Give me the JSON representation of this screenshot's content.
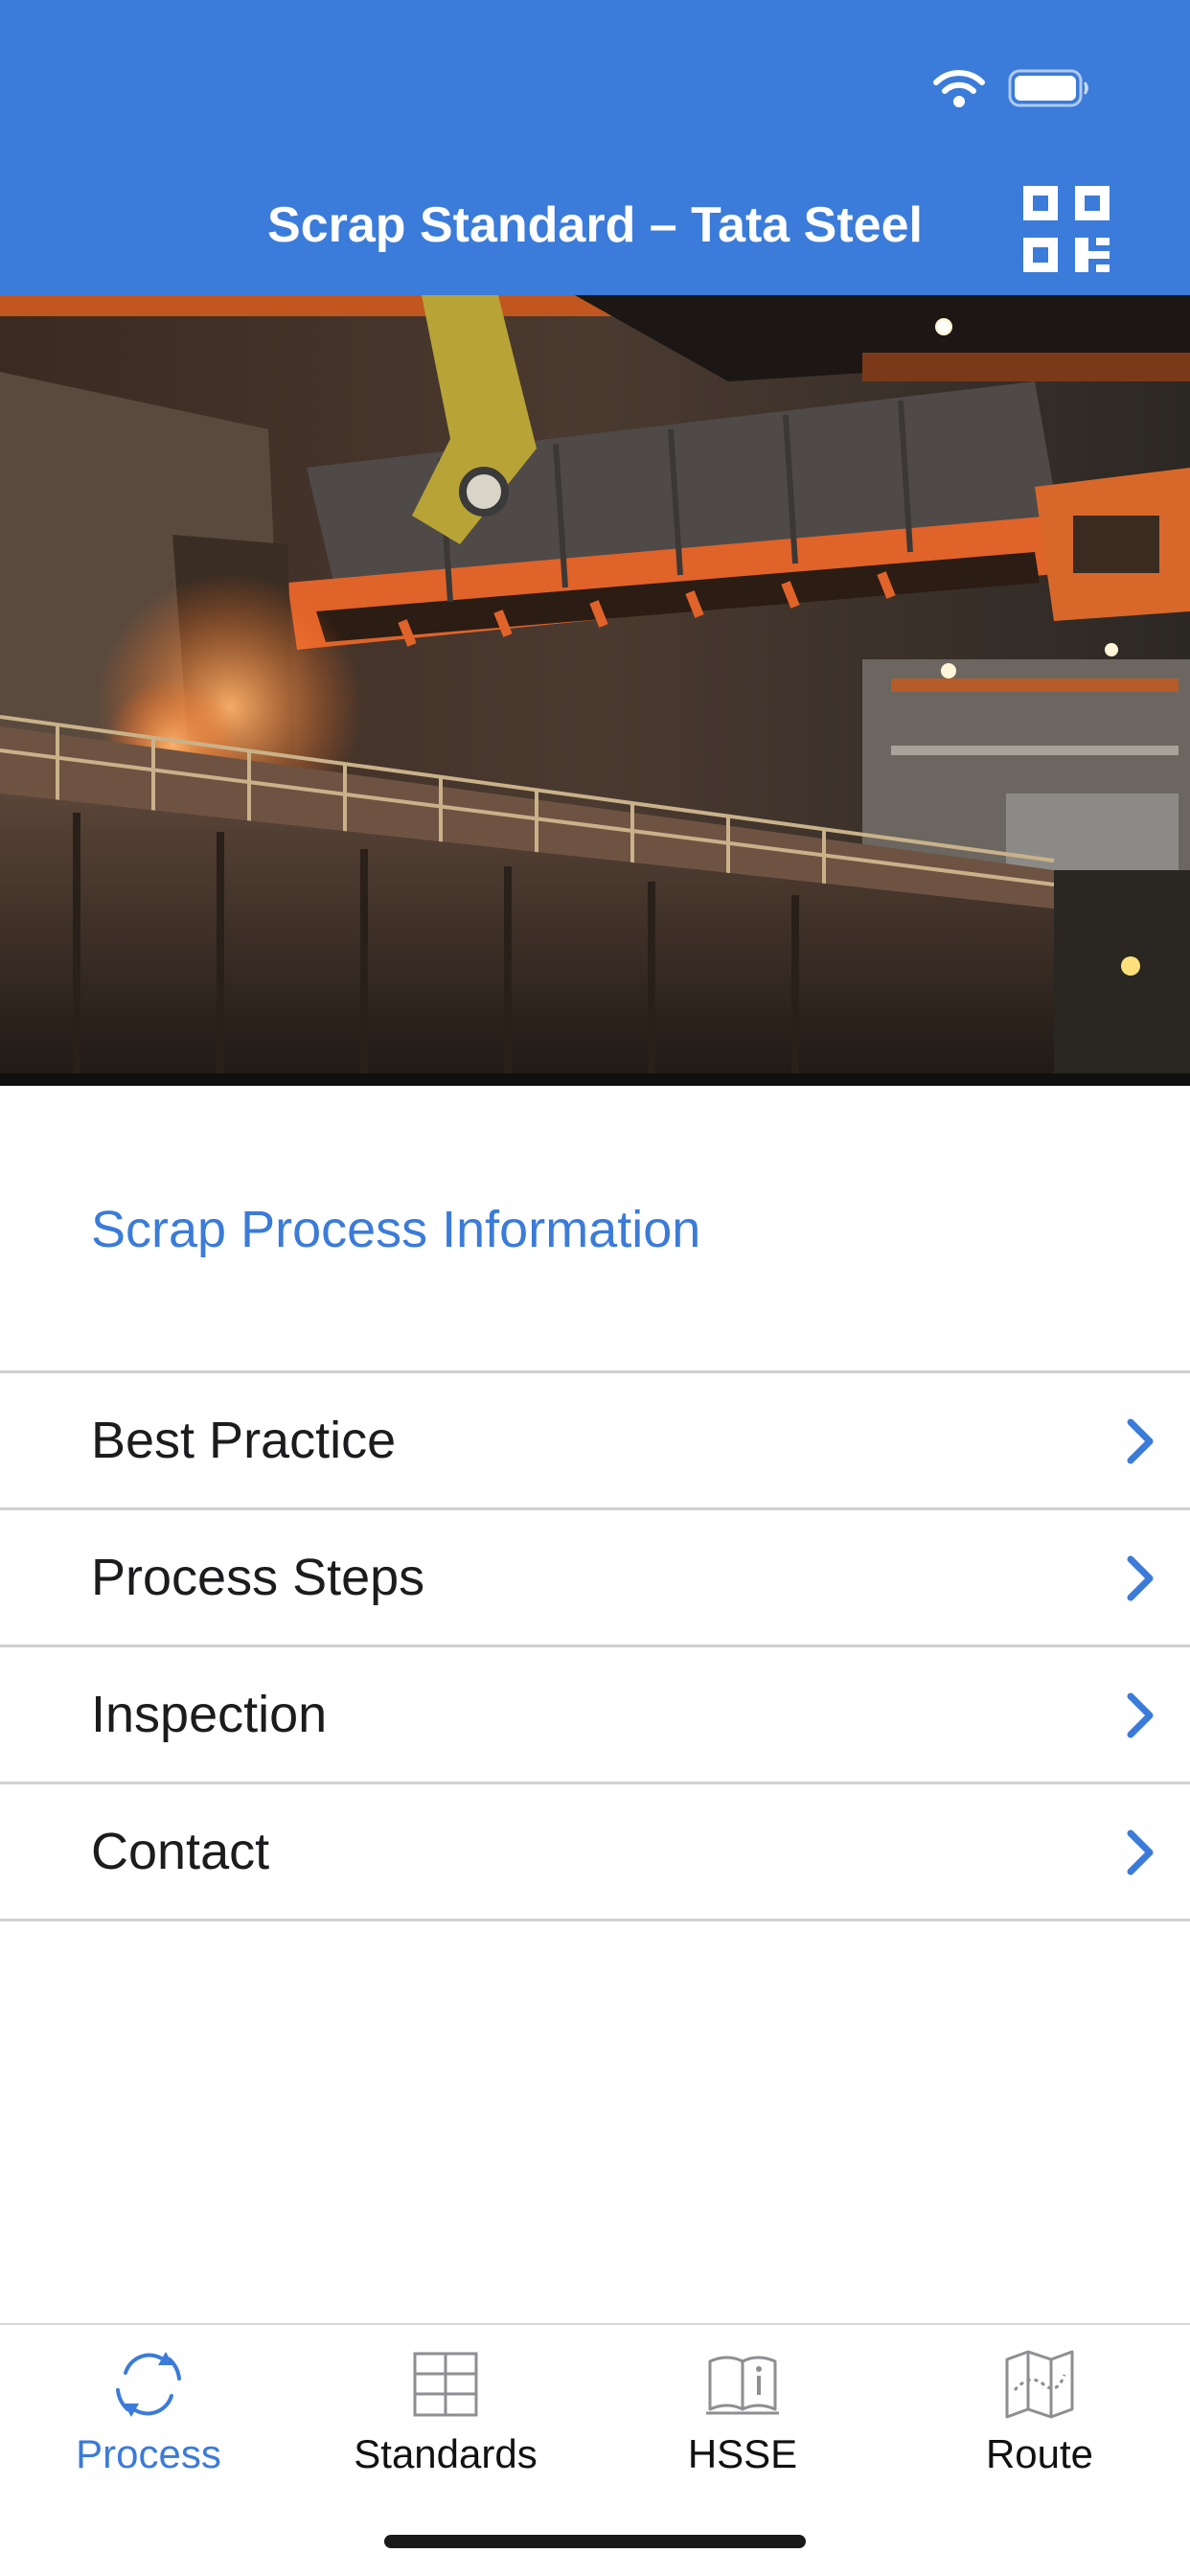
{
  "header": {
    "title": "Scrap Standard – Tata Steel",
    "bg_color": "#3b7bd9",
    "qr_icon": "qr-code-icon"
  },
  "status_bar": {
    "icons": [
      "wifi-icon",
      "battery-icon"
    ]
  },
  "hero": {
    "image": "steel-plant-crane-photo"
  },
  "section": {
    "title": "Scrap Process Information"
  },
  "menu": {
    "items": [
      {
        "label": "Best Practice"
      },
      {
        "label": "Process Steps"
      },
      {
        "label": "Inspection"
      },
      {
        "label": "Contact"
      }
    ]
  },
  "tabbar": {
    "tabs": [
      {
        "label": "Process",
        "icon": "refresh-cycle-icon",
        "active": true
      },
      {
        "label": "Standards",
        "icon": "grid-table-icon",
        "active": false
      },
      {
        "label": "HSSE",
        "icon": "info-book-icon",
        "active": false
      },
      {
        "label": "Route",
        "icon": "map-route-icon",
        "active": false
      }
    ]
  },
  "colors": {
    "accent": "#3b7bd9",
    "text": "#1c1c1e",
    "separator": "#d0d0d4"
  }
}
